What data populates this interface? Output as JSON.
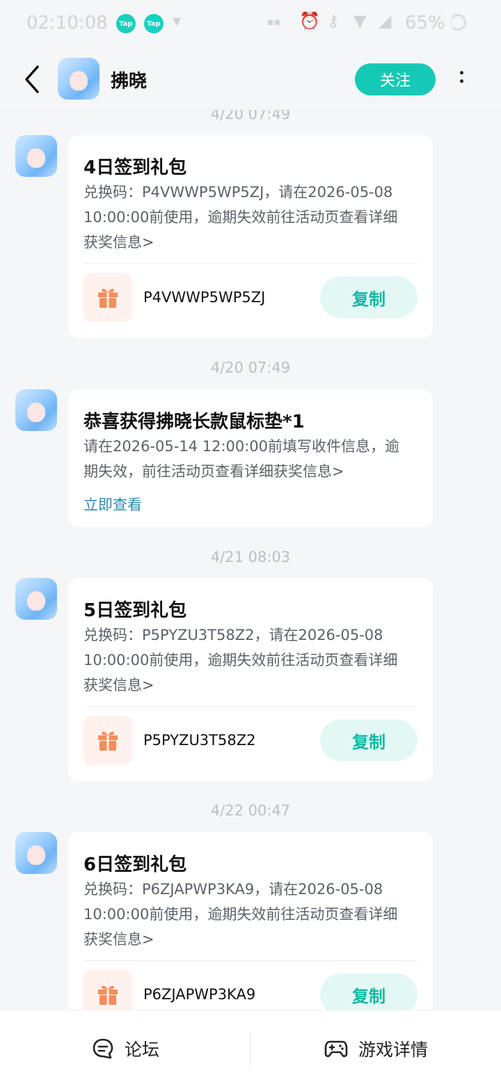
{
  "status_bar": {
    "time": "02:10:08",
    "app_badge": "Tap",
    "battery": "65%"
  },
  "header": {
    "title": "拂晓",
    "follow_label": "关注"
  },
  "messages": [
    {
      "timestamp": "4/20  07:49",
      "title": "4日签到礼包",
      "desc_lines": [
        "兑换码：P4VWWP5WP5ZJ，请在2026-05-08",
        "10:00:00前使用，逾期失效前往活动页查看详细",
        "获奖信息>"
      ],
      "code": "P4VWWP5WP5ZJ",
      "copy_label": "复制"
    },
    {
      "timestamp": "4/20  07:49",
      "title": "恭喜获得拂晓长款鼠标垫*1",
      "desc_lines": [
        "请在2026-05-14 12:00:00前填写收件信息，逾",
        "期失效，前往活动页查看详细获奖信息>"
      ],
      "link": "立即查看"
    },
    {
      "timestamp": "4/21  08:03",
      "title": "5日签到礼包",
      "desc_lines": [
        "兑换码：P5PYZU3T58Z2，请在2026-05-08",
        "10:00:00前使用，逾期失效前往活动页查看详细",
        "获奖信息>"
      ],
      "code": "P5PYZU3T58Z2",
      "copy_label": "复制"
    },
    {
      "timestamp": "4/22  00:47",
      "title": "6日签到礼包",
      "desc_lines": [
        "兑换码：P6ZJAPWP3KA9，请在2026-05-08",
        "10:00:00前使用，逾期失效前往活动页查看详细",
        "获奖信息>"
      ],
      "code": "P6ZJAPWP3KA9",
      "copy_label": "复制"
    }
  ],
  "bottom_bar": {
    "forum_label": "论坛",
    "game_details_label": "游戏详情"
  },
  "colors": {
    "accent": "#15c9b7",
    "gift": "#f58d5c",
    "link": "#2c8dab"
  }
}
